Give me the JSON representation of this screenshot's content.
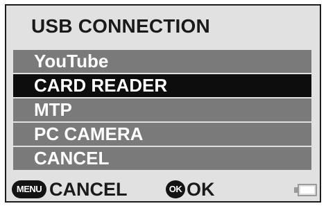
{
  "title": "USB CONNECTION",
  "menu": {
    "items": [
      {
        "label": "YouTube",
        "selected": false
      },
      {
        "label": "CARD READER",
        "selected": true
      },
      {
        "label": "MTP",
        "selected": false
      },
      {
        "label": "PC CAMERA",
        "selected": false
      },
      {
        "label": "CANCEL",
        "selected": false
      }
    ]
  },
  "bottom": {
    "menu_button_text": "MENU",
    "cancel_label": "CANCEL",
    "ok_button_text": "OK",
    "ok_label": "OK"
  },
  "battery": {
    "level": 1.0,
    "icon": "battery-icon"
  },
  "colors": {
    "background": "#e1e1e1",
    "menu_item": "#7a7a7a",
    "menu_item_selected": "#0d0d0d",
    "text": "#1a1a1a"
  }
}
